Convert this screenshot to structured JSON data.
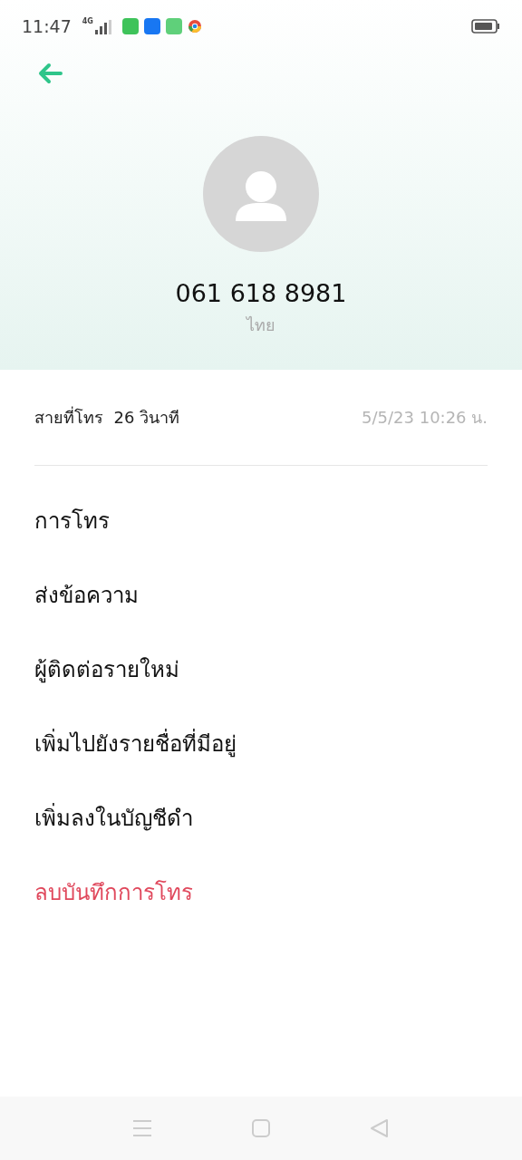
{
  "status_bar": {
    "time": "11:47",
    "network": "4G"
  },
  "contact": {
    "number": "061 618 8981",
    "location": "ไทย"
  },
  "call_log": {
    "summary": "สายที่โทร  26 วินาที",
    "timestamp": "5/5/23 10:26 น."
  },
  "actions": [
    {
      "label": "การโทร",
      "kind": "normal"
    },
    {
      "label": "ส่งข้อความ",
      "kind": "normal"
    },
    {
      "label": "ผู้ติดต่อรายใหม่",
      "kind": "normal"
    },
    {
      "label": "เพิ่มไปยังรายชื่อที่มีอยู่",
      "kind": "normal"
    },
    {
      "label": "เพิ่มลงในบัญชีดำ",
      "kind": "normal"
    },
    {
      "label": "ลบบันทึกการโทร",
      "kind": "destructive"
    }
  ]
}
